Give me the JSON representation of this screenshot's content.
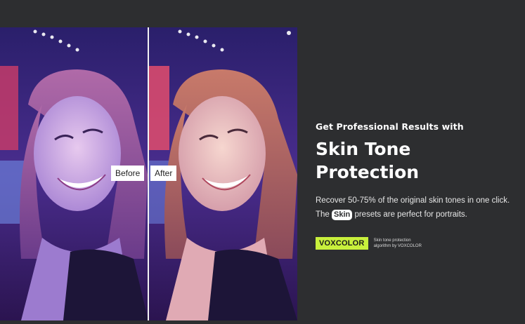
{
  "comparison": {
    "before_label": "Before",
    "after_label": "After"
  },
  "promo": {
    "eyebrow": "Get Professional Results with",
    "headline_line1": "Skin Tone",
    "headline_line2": "Protection",
    "body_part1": "Recover 50-75% of the original skin tones in one click.  The ",
    "body_pill": "Skin",
    "body_part2": " presets are perfect for portraits."
  },
  "brand": {
    "name": "VOXCOLOR",
    "note_line1": "Skin tone protection",
    "note_line2": "algorithm by VOXCOLOR",
    "accent": "#c8f03c"
  }
}
